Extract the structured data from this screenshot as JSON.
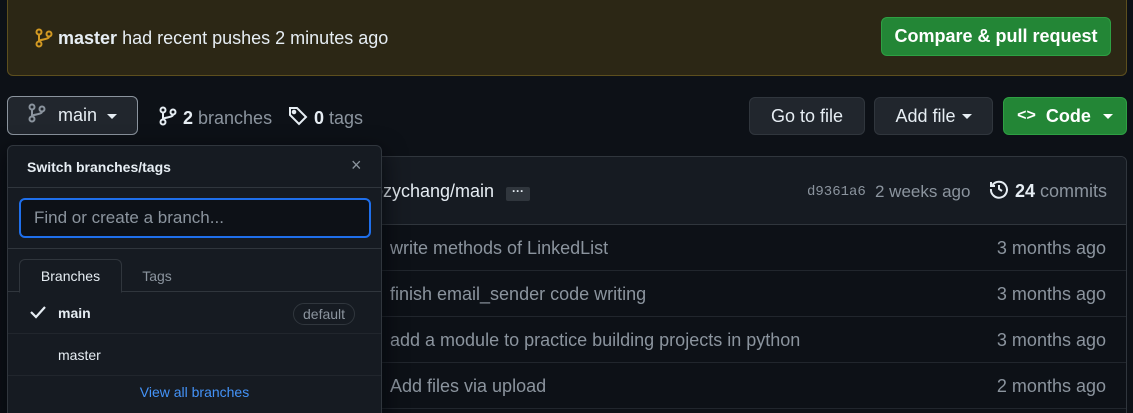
{
  "banner": {
    "branch": "master",
    "message": "had recent pushes 2 minutes ago",
    "compare_label": "Compare & pull request"
  },
  "toolbar": {
    "branch_label": "main",
    "branches_count": "2",
    "branches_label": "branches",
    "tags_count": "0",
    "tags_label": "tags",
    "go_to_file": "Go to file",
    "add_file": "Add file",
    "code": "Code"
  },
  "commit_header": {
    "author": "ozychang/main",
    "more": "···",
    "sha": "d9361a6",
    "time": "2 weeks ago",
    "commits_count": "24",
    "commits_label": "commits"
  },
  "files": [
    {
      "message": "write methods of LinkedList",
      "time": "3 months ago"
    },
    {
      "message": "finish email_sender code writing",
      "time": "3 months ago"
    },
    {
      "message": "add a module to practice building projects in python",
      "time": "3 months ago"
    },
    {
      "message": "Add files via upload",
      "time": "2 months ago"
    }
  ],
  "dropdown": {
    "title": "Switch branches/tags",
    "close": "×",
    "placeholder": "Find or create a branch...",
    "tabs": [
      "Branches",
      "Tags"
    ],
    "items": [
      {
        "name": "main",
        "badge": "default",
        "selected": true
      },
      {
        "name": "master",
        "badge": "",
        "selected": false
      }
    ],
    "footer": "View all branches"
  },
  "colors": {
    "accent_green": "#238636",
    "link_blue": "#4493f8",
    "banner_bg": "#2c2715"
  }
}
